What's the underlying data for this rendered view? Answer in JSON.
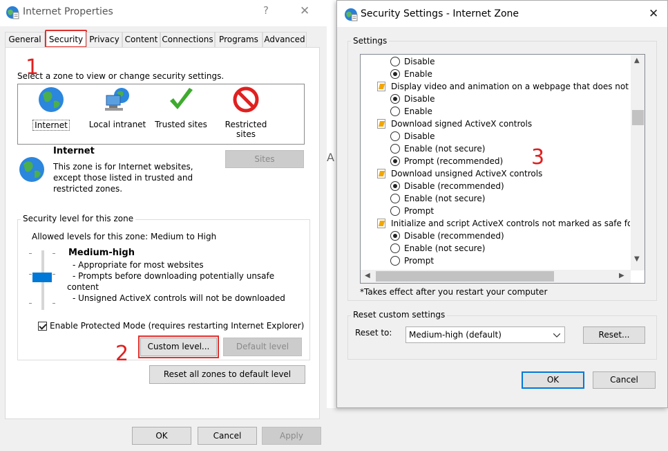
{
  "internet_properties": {
    "title": "Internet Properties",
    "help_glyph": "?",
    "close_glyph": "✕",
    "tabs": [
      {
        "label": "General"
      },
      {
        "label": "Security"
      },
      {
        "label": "Privacy"
      },
      {
        "label": "Content"
      },
      {
        "label": "Connections"
      },
      {
        "label": "Programs"
      },
      {
        "label": "Advanced"
      }
    ],
    "zone_prompt": "Select a zone to view or change security settings.",
    "zones": [
      {
        "label": "Internet",
        "icon": "globe-icon"
      },
      {
        "label": "Local intranet",
        "icon": "intranet-icon"
      },
      {
        "label": "Trusted sites",
        "icon": "checkmark-icon"
      },
      {
        "label": "Restricted sites",
        "icon": "restricted-icon"
      }
    ],
    "zone_info": {
      "title": "Internet",
      "description_lines": [
        "This zone is for Internet websites,",
        "except those listed in trusted and",
        "restricted zones."
      ]
    },
    "sites_button": "Sites",
    "security_level_group": "Security level for this zone",
    "allowed_levels": "Allowed levels for this zone: Medium to High",
    "level_name": "Medium-high",
    "level_points": [
      "- Appropriate for most websites",
      "- Prompts before downloading potentially unsafe",
      "content",
      "- Unsigned ActiveX controls will not be downloaded"
    ],
    "protected_mode_label": "Enable Protected Mode (requires restarting Internet Explorer)",
    "protected_mode_checked": true,
    "custom_level_button": "Custom level...",
    "default_level_button": "Default level",
    "reset_all_button": "Reset all zones to default level",
    "ok_button": "OK",
    "cancel_button": "Cancel",
    "apply_button": "Apply"
  },
  "annotations": [
    "1",
    "2",
    "3"
  ],
  "security_settings": {
    "title": "Security Settings - Internet Zone",
    "close_glyph": "✕",
    "settings_group": "Settings",
    "rows": [
      {
        "kind": "radio",
        "label": "Disable",
        "checked": false
      },
      {
        "kind": "radio",
        "label": "Enable",
        "checked": true
      },
      {
        "kind": "heading",
        "label": "Display video and animation on a webpage that does not use"
      },
      {
        "kind": "radio",
        "label": "Disable",
        "checked": true
      },
      {
        "kind": "radio",
        "label": "Enable",
        "checked": false
      },
      {
        "kind": "heading",
        "label": "Download signed ActiveX controls"
      },
      {
        "kind": "radio",
        "label": "Disable",
        "checked": false
      },
      {
        "kind": "radio",
        "label": "Enable (not secure)",
        "checked": false
      },
      {
        "kind": "radio",
        "label": "Prompt (recommended)",
        "checked": true
      },
      {
        "kind": "heading",
        "label": "Download unsigned ActiveX controls"
      },
      {
        "kind": "radio",
        "label": "Disable (recommended)",
        "checked": true
      },
      {
        "kind": "radio",
        "label": "Enable (not secure)",
        "checked": false
      },
      {
        "kind": "radio",
        "label": "Prompt",
        "checked": false
      },
      {
        "kind": "heading",
        "label": "Initialize and script ActiveX controls not marked as safe for s"
      },
      {
        "kind": "radio",
        "label": "Disable (recommended)",
        "checked": true
      },
      {
        "kind": "radio",
        "label": "Enable (not secure)",
        "checked": false
      },
      {
        "kind": "radio",
        "label": "Prompt",
        "checked": false
      }
    ],
    "restart_note": "*Takes effect after you restart your computer",
    "reset_group": "Reset custom settings",
    "reset_to_label": "Reset to:",
    "reset_to_value": "Medium-high (default)",
    "reset_button": "Reset...",
    "ok_button": "OK",
    "cancel_button": "Cancel"
  },
  "background_fragments": {
    "ar_text": "ar",
    "a_text": "A",
    "default_text": "Default"
  },
  "colors": {
    "annotation_red": "#e02020",
    "focus_blue": "#0078d7",
    "slider_blue": "#0078d7"
  }
}
